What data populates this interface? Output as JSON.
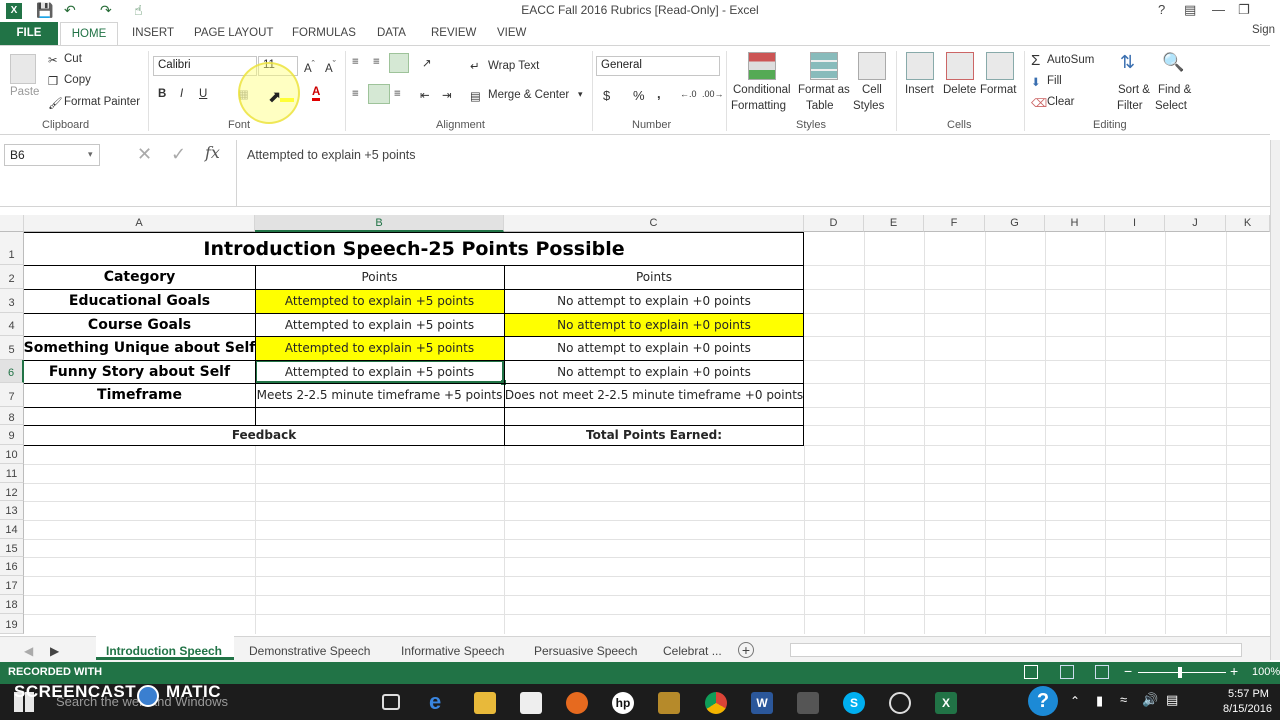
{
  "window": {
    "title": "EACC Fall 2016 Rubrics  [Read-Only] - Excel",
    "sign_in": "Sign"
  },
  "tabs": [
    "FILE",
    "HOME",
    "INSERT",
    "PAGE LAYOUT",
    "FORMULAS",
    "DATA",
    "REVIEW",
    "VIEW"
  ],
  "ribbon": {
    "clipboard": {
      "paste": "Paste",
      "cut": "Cut",
      "copy": "Copy",
      "format_painter": "Format Painter",
      "label": "Clipboard"
    },
    "font": {
      "name": "Calibri",
      "size": "11",
      "label": "Font",
      "bold": "B",
      "italic": "I",
      "underline": "U"
    },
    "alignment": {
      "wrap": "Wrap Text",
      "merge": "Merge & Center",
      "label": "Alignment"
    },
    "number": {
      "format": "General",
      "currency": "$",
      "percent": "%",
      "comma": ",",
      "label": "Number"
    },
    "styles": {
      "conditional": "Conditional",
      "conditional2": "Formatting",
      "format_table": "Format as",
      "format_table2": "Table",
      "cell_styles": "Cell",
      "cell_styles2": "Styles",
      "label": "Styles"
    },
    "cells": {
      "insert": "Insert",
      "delete": "Delete",
      "format": "Format",
      "label": "Cells"
    },
    "editing": {
      "autosum": "AutoSum",
      "fill": "Fill",
      "clear": "Clear",
      "sort": "Sort &",
      "sort2": "Filter",
      "find": "Find &",
      "find2": "Select",
      "label": "Editing"
    }
  },
  "formula_bar": {
    "name_box": "B6",
    "fx": "fx",
    "content": "Attempted to explain +5 points"
  },
  "columns": [
    "A",
    "B",
    "C",
    "D",
    "E",
    "F",
    "G",
    "H",
    "I",
    "J",
    "K"
  ],
  "rows": [
    "1",
    "2",
    "3",
    "4",
    "5",
    "6",
    "7",
    "8",
    "9",
    "10",
    "11",
    "12",
    "13",
    "14",
    "15",
    "16",
    "17",
    "18",
    "19"
  ],
  "sheet": {
    "title": "Introduction Speech-25 Points Possible",
    "header": {
      "category": "Category",
      "points_b": "Points",
      "points_c": "Points"
    },
    "rows": [
      {
        "category": "Educational Goals",
        "b": "Attempted to explain +5 points",
        "c": "No attempt to explain +0 points",
        "b_hl": true,
        "c_hl": false
      },
      {
        "category": "Course Goals",
        "b": "Attempted to explain +5 points",
        "c": "No attempt to explain +0 points",
        "b_hl": false,
        "c_hl": true
      },
      {
        "category": "Something Unique about Self",
        "b": "Attempted to explain +5 points",
        "c": "No attempt to explain +0 points",
        "b_hl": true,
        "c_hl": false
      },
      {
        "category": "Funny Story about Self",
        "b": "Attempted to explain +5 points",
        "c": "No attempt to explain +0 points",
        "b_hl": false,
        "c_hl": false
      },
      {
        "category": "Timeframe",
        "b": "Meets 2-2.5 minute timeframe +5 points",
        "c": "Does not meet 2-2.5 minute timeframe +0 points",
        "b_hl": false,
        "c_hl": false
      }
    ],
    "feedback": "Feedback",
    "total": "Total Points Earned:"
  },
  "sheet_tabs": [
    "Introduction Speech",
    "Demonstrative Speech",
    "Informative Speech",
    "Persuasive Speech",
    "Celebrat ..."
  ],
  "status": {
    "recorded": "RECORDED WITH",
    "brand": "SCREENCAST",
    "brand2": "MATIC",
    "zoom": "100%"
  },
  "taskbar": {
    "search": "Search the web and Windows",
    "time": "5:57 PM",
    "date": "8/15/2016"
  },
  "colors": {
    "excel_green": "#217346",
    "highlight": "#ffff00"
  }
}
